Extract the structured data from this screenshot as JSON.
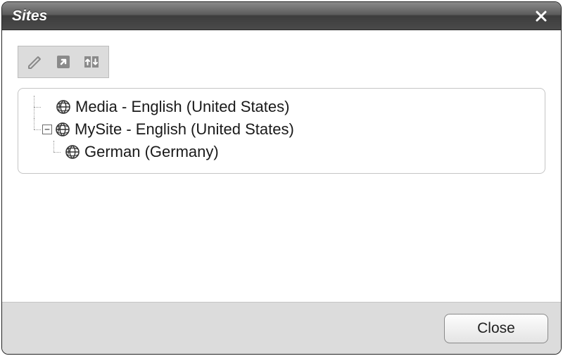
{
  "dialog": {
    "title": "Sites",
    "close_label": "Close"
  },
  "toolbar": {
    "edit": "Edit",
    "open_external": "Open",
    "compare": "Compare"
  },
  "tree": {
    "items": [
      {
        "label": "Media - English (United States)",
        "expandable": false,
        "children": []
      },
      {
        "label": "MySite - English (United States)",
        "expandable": true,
        "expanded": true,
        "children": [
          {
            "label": "German (Germany)"
          }
        ]
      }
    ]
  },
  "footer": {
    "close": "Close"
  }
}
